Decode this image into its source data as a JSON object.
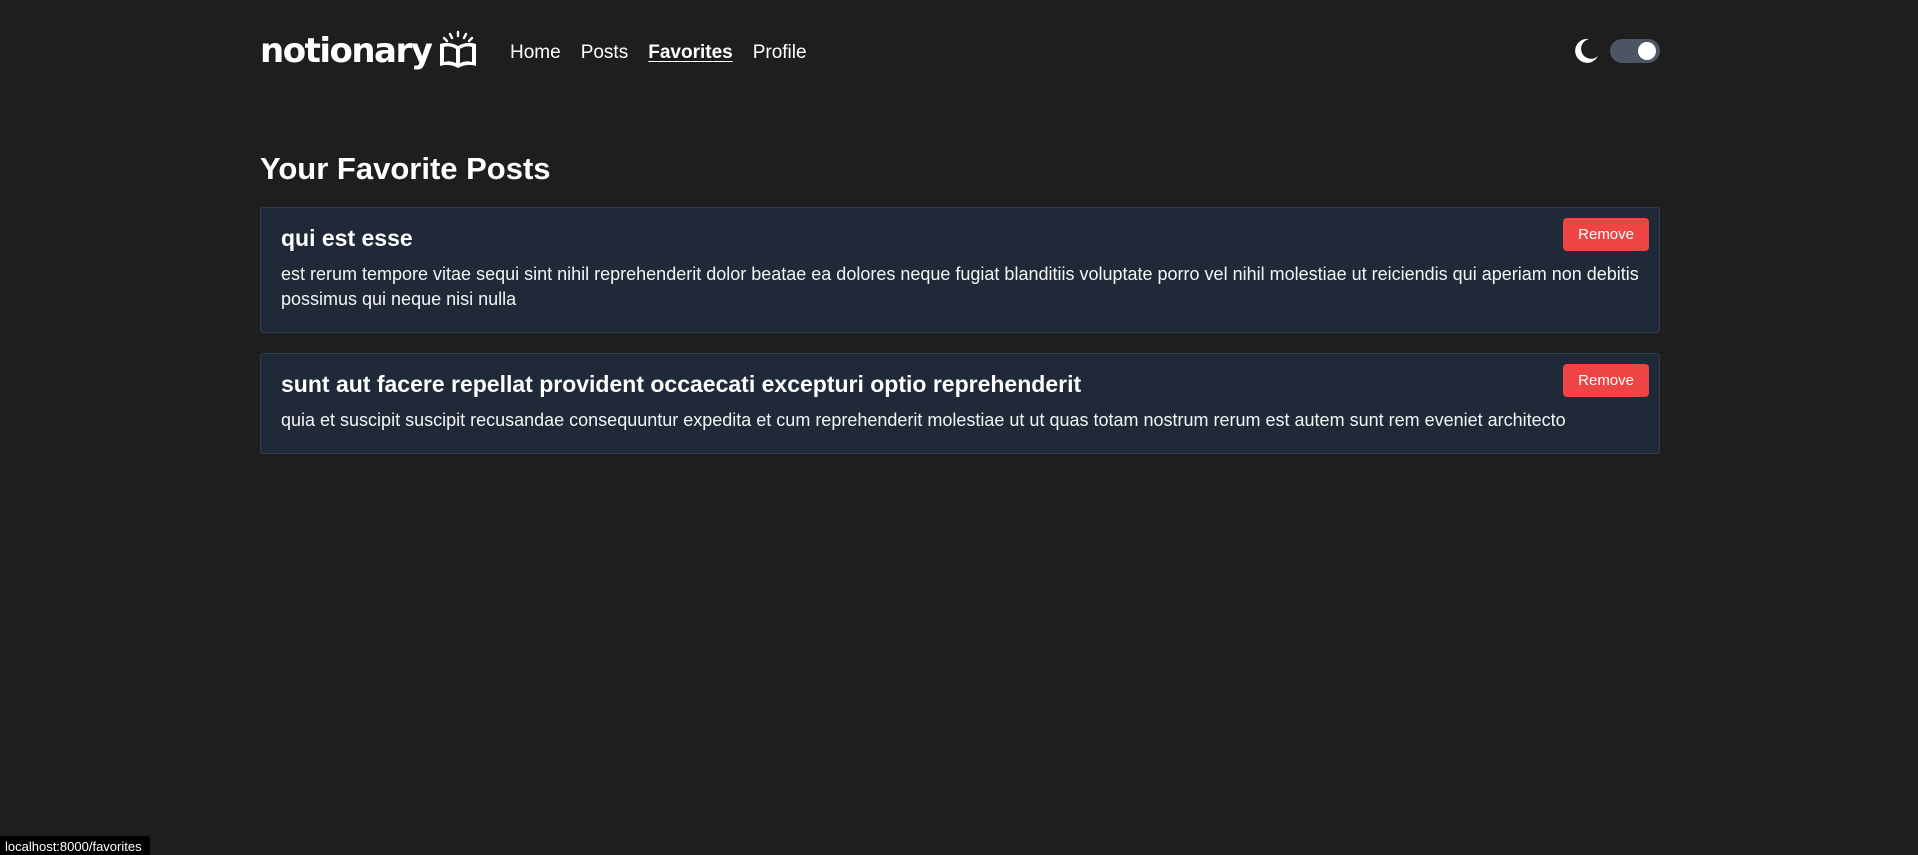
{
  "header": {
    "logo_text": "notionary",
    "nav": [
      {
        "label": "Home",
        "active": false
      },
      {
        "label": "Posts",
        "active": false
      },
      {
        "label": "Favorites",
        "active": true
      },
      {
        "label": "Profile",
        "active": false
      }
    ],
    "theme_icon": "moon-icon",
    "dark_mode_on": true
  },
  "main": {
    "title": "Your Favorite Posts",
    "posts": [
      {
        "title": "qui est esse",
        "body": "est rerum tempore vitae sequi sint nihil reprehenderit dolor beatae ea dolores neque fugiat blanditiis voluptate porro vel nihil molestiae ut reiciendis qui aperiam non debitis possimus qui neque nisi nulla",
        "remove_label": "Remove"
      },
      {
        "title": "sunt aut facere repellat provident occaecati excepturi optio reprehenderit",
        "body": "quia et suscipit suscipit recusandae consequuntur expedita et cum reprehenderit molestiae ut ut quas totam nostrum rerum est autem sunt rem eveniet architecto",
        "remove_label": "Remove"
      }
    ]
  },
  "status_bar": {
    "url": "localhost:8000/favorites"
  },
  "colors": {
    "background": "#1e1e1e",
    "card": "#1f2937",
    "danger": "#ef4444"
  }
}
